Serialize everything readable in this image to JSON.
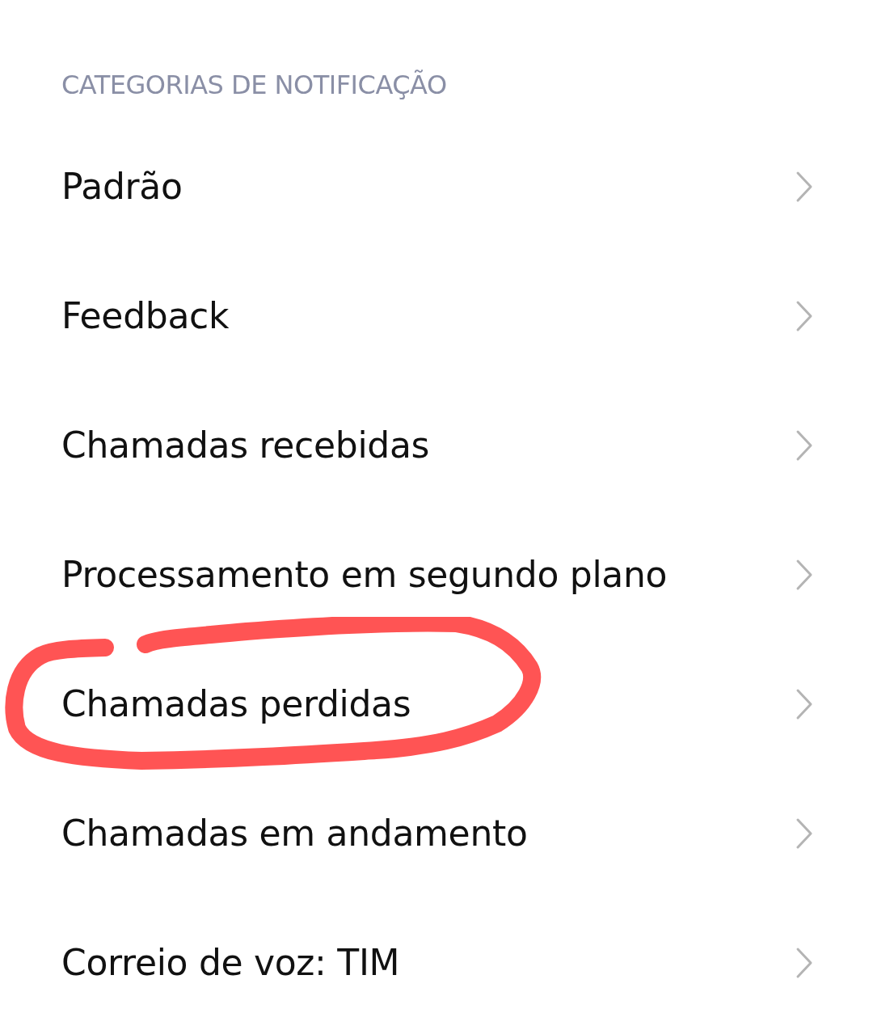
{
  "section_title": "CATEGORIAS DE NOTIFICAÇÃO",
  "items": [
    {
      "label": "Padrão",
      "circled": false
    },
    {
      "label": "Feedback",
      "circled": false
    },
    {
      "label": "Chamadas recebidas",
      "circled": false
    },
    {
      "label": "Processamento em segundo plano",
      "circled": false
    },
    {
      "label": "Chamadas perdidas",
      "circled": true
    },
    {
      "label": "Chamadas em andamento",
      "circled": false
    },
    {
      "label": "Correio de voz: TIM",
      "circled": false
    }
  ]
}
